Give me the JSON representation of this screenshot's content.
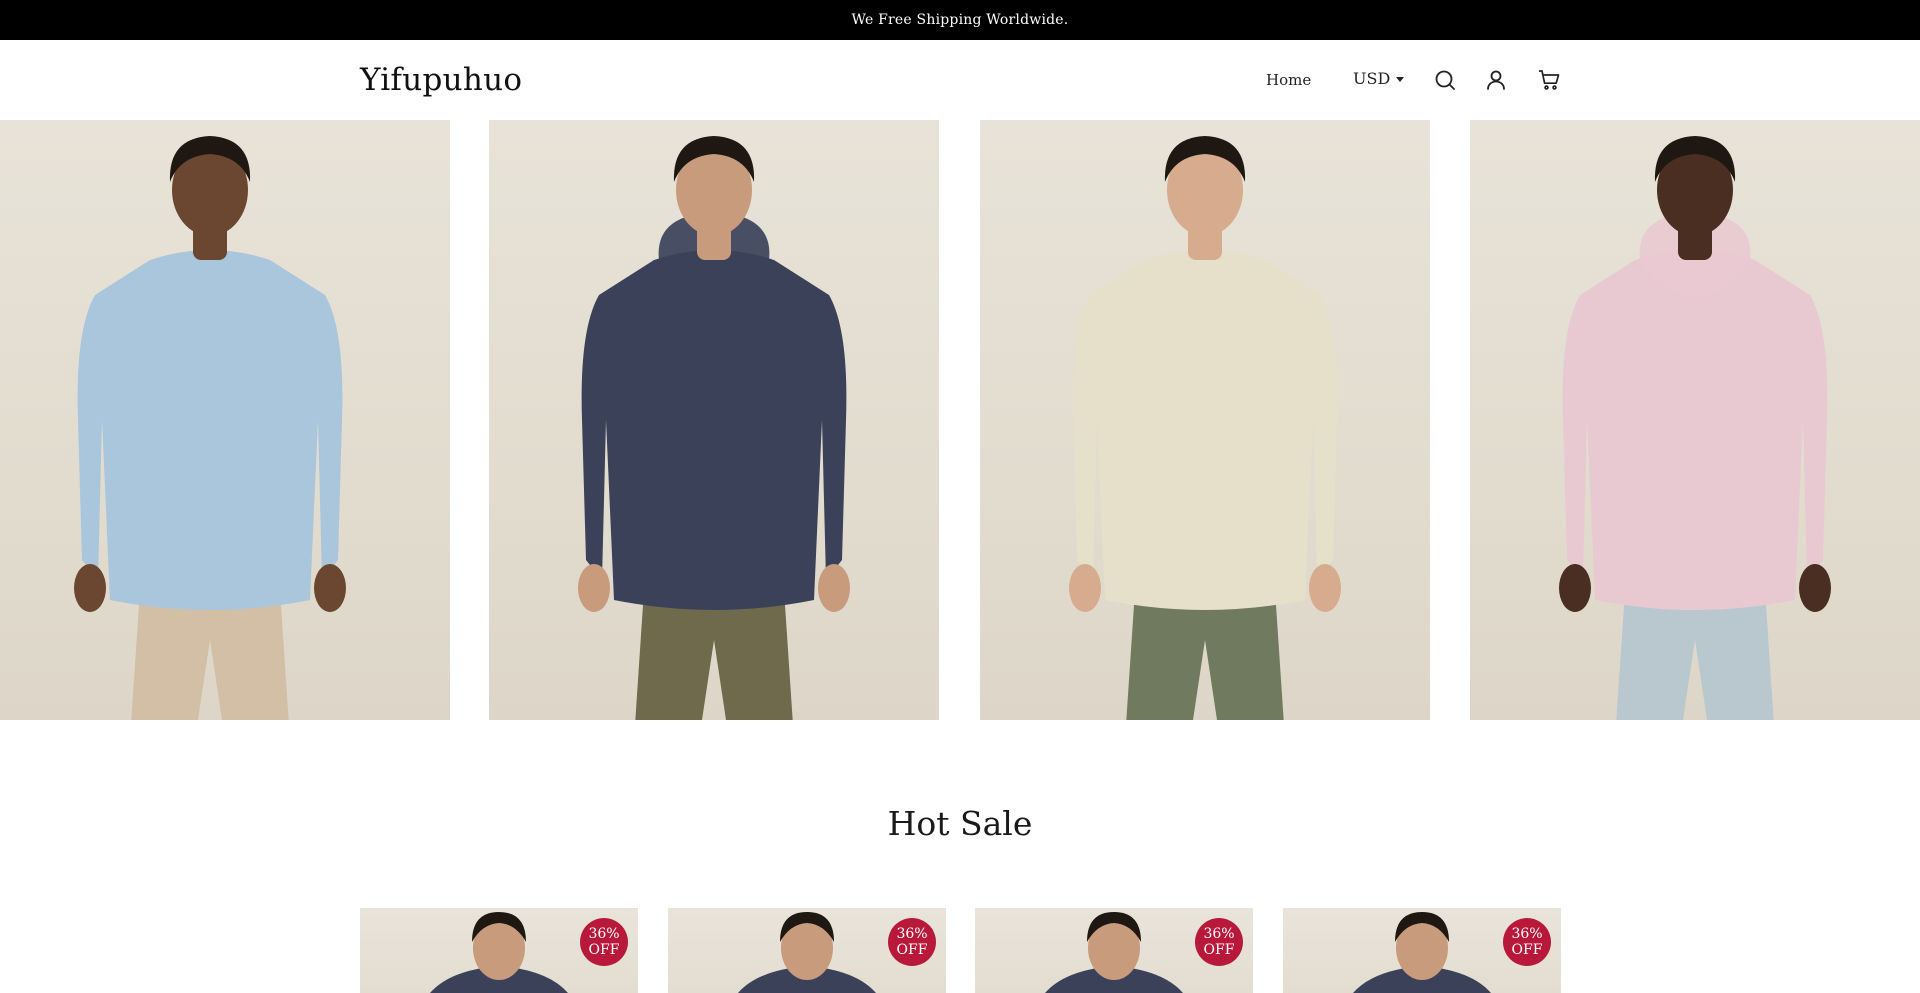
{
  "announcement": {
    "text": "We Free Shipping Worldwide."
  },
  "header": {
    "logo": "Yifupuhuo",
    "nav_home": "Home",
    "currency": "USD",
    "icons": [
      "search-icon",
      "account-icon",
      "cart-icon"
    ]
  },
  "hero": {
    "slides": [
      {
        "shirt_color": "#a9c6dc",
        "pants_color": "#d2bfa5",
        "skin": "#6b4630",
        "garment": "denim shirt"
      },
      {
        "shirt_color": "#3b4159",
        "pants_color": "#6f6a4c",
        "skin": "#c79b7c",
        "garment": "navy hoodie"
      },
      {
        "shirt_color": "#e6dfca",
        "pants_color": "#6f7a5e",
        "skin": "#d7ab8e",
        "garment": "cream shirt"
      },
      {
        "shirt_color": "#e9c9d1",
        "pants_color": "#b9c8cf",
        "skin": "#4a2e22",
        "garment": "pink hoodie"
      }
    ]
  },
  "hot_sale": {
    "title": "Hot Sale",
    "products": [
      {
        "badge_line1": "36%",
        "badge_line2": "OFF"
      },
      {
        "badge_line1": "36%",
        "badge_line2": "OFF"
      },
      {
        "badge_line1": "36%",
        "badge_line2": "OFF"
      },
      {
        "badge_line1": "36%",
        "badge_line2": "OFF"
      }
    ]
  },
  "colors": {
    "announcement_bg": "#000000",
    "badge": "#b8193a",
    "photo_backdrop": "#e6e0d5"
  }
}
